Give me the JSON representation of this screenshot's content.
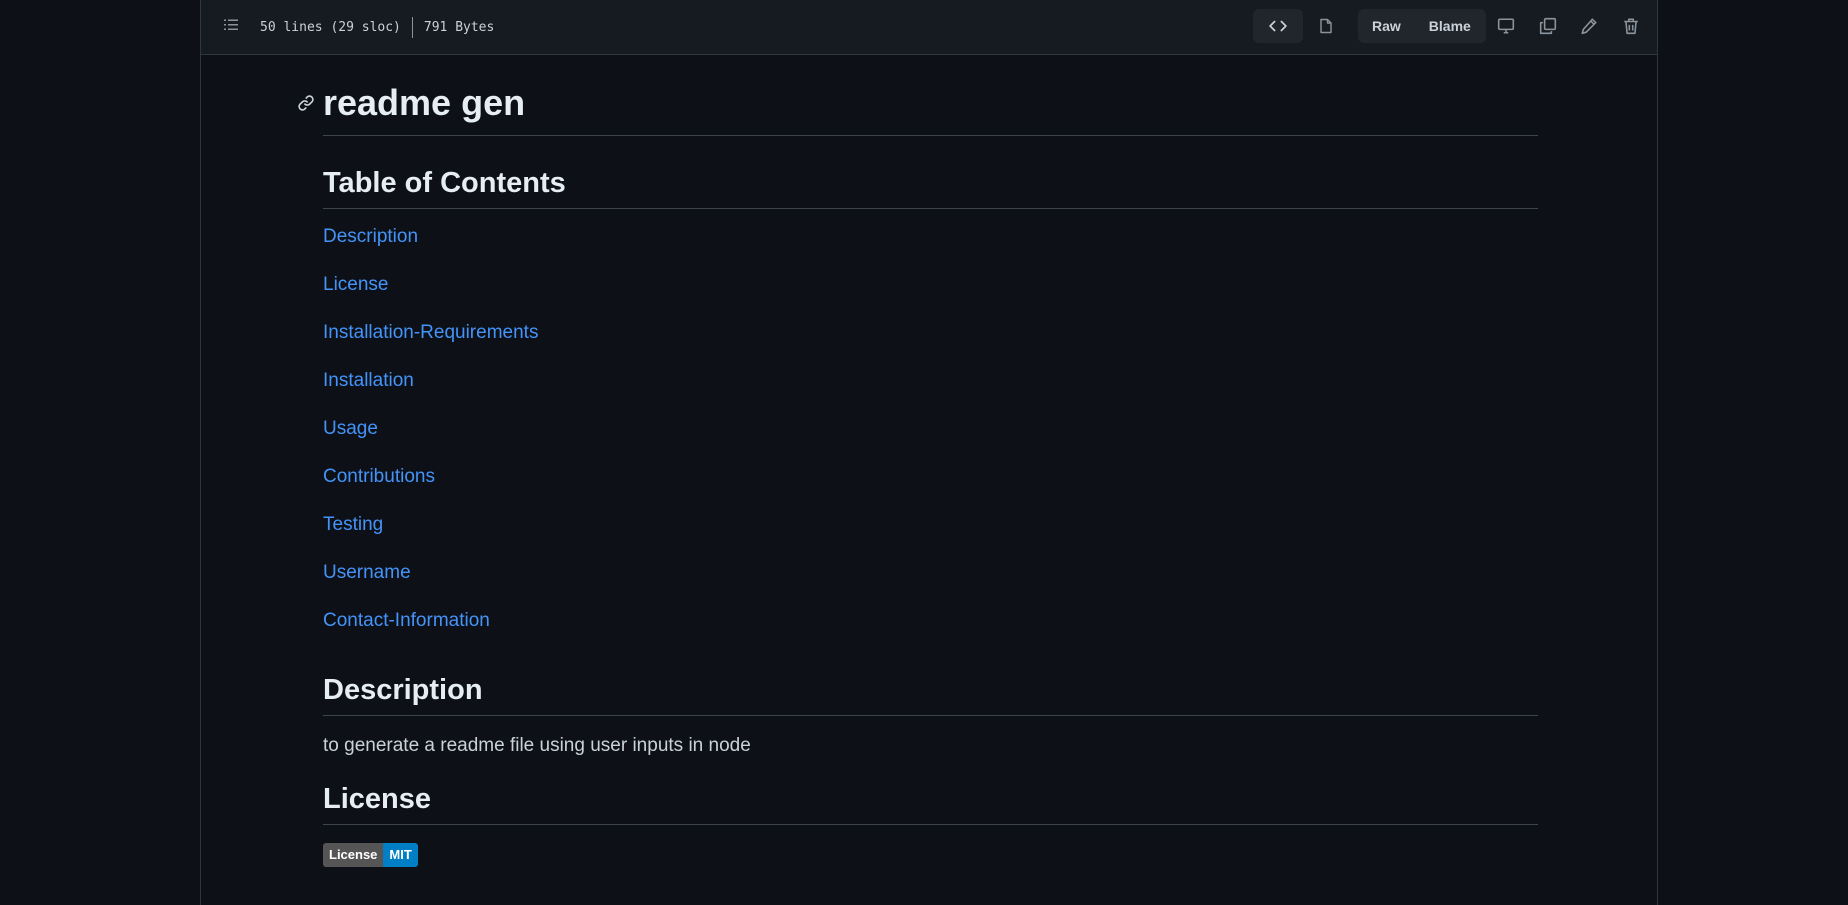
{
  "toolbar": {
    "lines_info": "50 lines (29 sloc)",
    "size_info": "791 Bytes",
    "raw_label": "Raw",
    "blame_label": "Blame"
  },
  "readme": {
    "title": "readme gen",
    "toc_heading": "Table of Contents",
    "toc_items": [
      "Description",
      "License",
      "Installation-Requirements",
      "Installation",
      "Usage",
      "Contributions",
      "Testing",
      "Username",
      "Contact-Information"
    ],
    "description_heading": "Description",
    "description_text": "to generate a readme file using user inputs in node",
    "license_heading": "License",
    "license_badge": {
      "label": "License",
      "value": "MIT"
    }
  },
  "colors": {
    "background": "#0d1117",
    "link": "#4493f8",
    "badge_left": "#555555",
    "badge_right": "#007ec6"
  },
  "icons": [
    "list-outline-icon",
    "code-icon",
    "file-icon",
    "desktop-icon",
    "copy-icon",
    "pencil-icon",
    "trash-icon",
    "link-icon"
  ]
}
